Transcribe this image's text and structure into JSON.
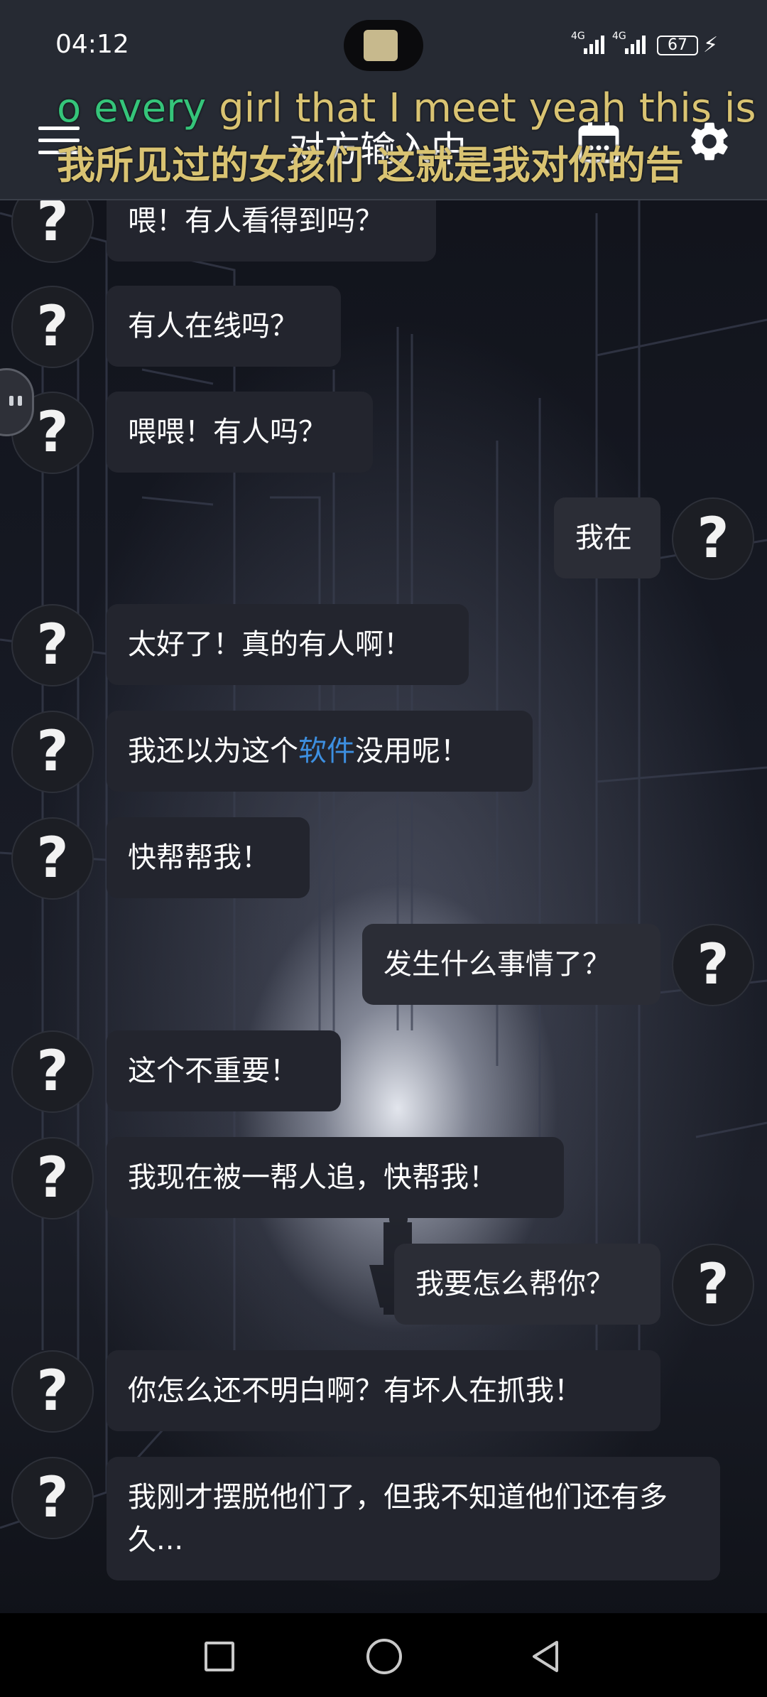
{
  "status_bar": {
    "time": "04:12",
    "network1": "4G",
    "network2": "4G",
    "battery": "67"
  },
  "header": {
    "title": "对方输入中.",
    "menu_icon": "hamburger-menu-icon",
    "calendar_icon": "calendar-icon",
    "settings_icon": "gear-icon"
  },
  "lyrics": {
    "english_sung": "o every",
    "english_rest": " girl that I meet yeah this is",
    "chinese": "我所见过的女孩们 这就是我对你的告"
  },
  "avatar_glyph": "?",
  "messages": [
    {
      "side": "left",
      "text": "喂！有人看得到吗？"
    },
    {
      "side": "left",
      "text": "有人在线吗？"
    },
    {
      "side": "left",
      "text": "喂喂！有人吗？"
    },
    {
      "side": "right",
      "text": "我在"
    },
    {
      "side": "left",
      "text": "太好了！真的有人啊！"
    },
    {
      "side": "left",
      "text_before": "我还以为这个",
      "highlight": "软件",
      "text_after": "没用呢！"
    },
    {
      "side": "left",
      "text": "快帮帮我！"
    },
    {
      "side": "right",
      "text": "发生什么事情了？"
    },
    {
      "side": "left",
      "text": "这个不重要！"
    },
    {
      "side": "left",
      "text": "我现在被一帮人追，快帮我！"
    },
    {
      "side": "right",
      "text": "我要怎么帮你？"
    },
    {
      "side": "left",
      "text": "你怎么还不明白啊？有坏人在抓我！"
    },
    {
      "side": "left",
      "text": "我刚才摆脱他们了，但我不知道他们还有多久..."
    }
  ],
  "colors": {
    "bar_bg": "#262a33",
    "bubble_bg": "#23252e",
    "link": "#3d8fe0",
    "lyric_sung": "#35c47a",
    "lyric_pending": "#d9c372"
  },
  "nav": {
    "recent_icon": "square-recent-apps-icon",
    "home_icon": "circle-home-icon",
    "back_icon": "triangle-back-icon"
  }
}
